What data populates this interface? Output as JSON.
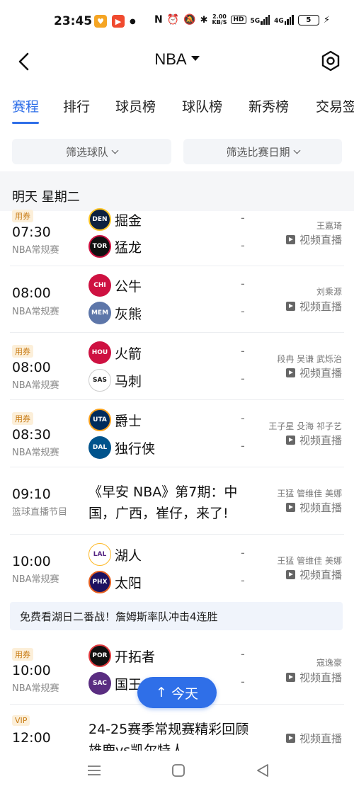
{
  "status_bar": {
    "time": "23:45",
    "net_speed": "2.00\nKB/S",
    "hd": "HD",
    "sig1": "5G",
    "sig2": "4G",
    "battery": "5"
  },
  "header": {
    "title": "NBA"
  },
  "tabs": [
    {
      "label": "赛程",
      "active": true
    },
    {
      "label": "排行"
    },
    {
      "label": "球员榜"
    },
    {
      "label": "球队榜"
    },
    {
      "label": "新秀榜"
    },
    {
      "label": "交易签"
    }
  ],
  "filters": {
    "team": "筛选球队",
    "date": "筛选比赛日期"
  },
  "date_section": {
    "label": "明天 星期二"
  },
  "games": [
    {
      "tag": "用券",
      "time": "07:30",
      "type": "NBA常规赛",
      "home": "掘金",
      "away": "猛龙",
      "score_home": "-",
      "score_away": "-",
      "commentators": "王嘉琦",
      "live": "视频直播"
    },
    {
      "tag": "",
      "time": "08:00",
      "type": "NBA常规赛",
      "home": "公牛",
      "away": "灰熊",
      "score_home": "-",
      "score_away": "-",
      "commentators": "刘乘源",
      "live": "视频直播"
    },
    {
      "tag": "用券",
      "time": "08:00",
      "type": "NBA常规赛",
      "home": "火箭",
      "away": "马刺",
      "score_home": "-",
      "score_away": "-",
      "commentators": "段冉 吴谦 武烁治",
      "live": "视频直播"
    },
    {
      "tag": "用券",
      "time": "08:30",
      "type": "NBA常规赛",
      "home": "爵士",
      "away": "独行侠",
      "score_home": "-",
      "score_away": "-",
      "commentators": "王子星 殳海 祁子艺",
      "live": "视频直播"
    },
    {
      "tag": "",
      "time": "09:10",
      "type": "篮球直播节目",
      "program": "《早安 NBA》第7期：中国，广西，崔仔，来了!",
      "commentators": "王猛 管维佳 美娜",
      "live": "视频直播"
    },
    {
      "tag": "",
      "time": "10:00",
      "type": "NBA常规赛",
      "home": "湖人",
      "away": "太阳",
      "score_home": "-",
      "score_away": "-",
      "commentators": "王猛 管维佳 美娜",
      "live": "视频直播"
    },
    {
      "tag": "用券",
      "time": "10:00",
      "type": "NBA常规赛",
      "home": "开拓者",
      "away": "国王",
      "score_home": "-",
      "score_away": "-",
      "commentators": "寇逸豪",
      "live": "视频直播"
    },
    {
      "tag": "VIP",
      "time": "12:00",
      "type": "",
      "program": "24-25赛季常规赛精彩回顾 雄鹿vs凯尔特人",
      "commentators": "",
      "live": "视频直播"
    }
  ],
  "banner": {
    "text": "免费看湖日二番战！詹姆斯率队冲击4连胜"
  },
  "today_button": {
    "label": "今天"
  },
  "colors": {
    "accent": "#2f6fe8",
    "tag_bg": "#fcefd9",
    "tag_fg": "#c77a12"
  }
}
